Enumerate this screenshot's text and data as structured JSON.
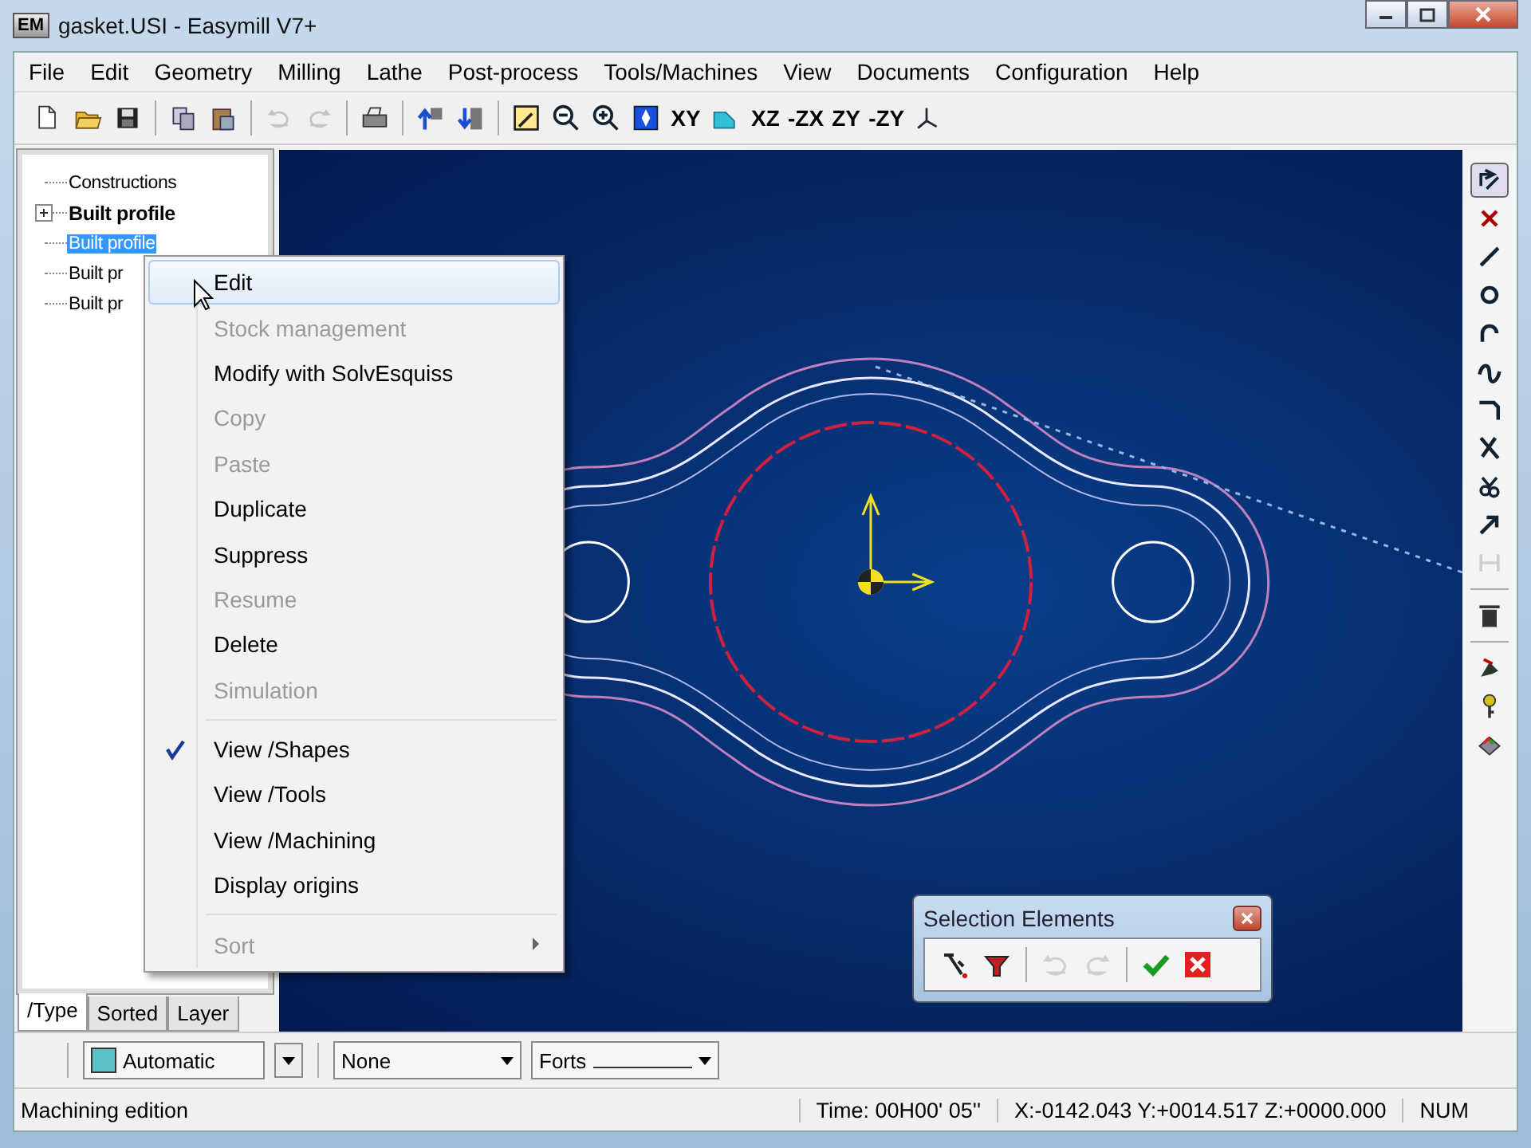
{
  "window": {
    "logo": "EM",
    "title": "gasket.USI - Easymill V7+"
  },
  "menu_bar": [
    "File",
    "Edit",
    "Geometry",
    "Milling",
    "Lathe",
    "Post-process",
    "Tools/Machines",
    "View",
    "Documents",
    "Configuration",
    "Help"
  ],
  "toolbar": [
    {
      "kind": "icon",
      "disabled": false
    },
    {
      "kind": "icon",
      "disabled": false
    },
    {
      "kind": "icon",
      "disabled": false
    },
    {
      "kind": "separator"
    },
    {
      "kind": "icon",
      "disabled": false
    },
    {
      "kind": "icon",
      "disabled": false
    },
    {
      "kind": "separator"
    },
    {
      "kind": "icon",
      "disabled": true
    },
    {
      "kind": "icon",
      "disabled": true
    },
    {
      "kind": "separator"
    },
    {
      "kind": "icon",
      "disabled": false
    },
    {
      "kind": "separator"
    },
    {
      "kind": "icon",
      "disabled": false
    },
    {
      "kind": "icon",
      "disabled": false
    },
    {
      "kind": "separator"
    },
    {
      "kind": "icon",
      "disabled": false
    },
    {
      "kind": "icon",
      "disabled": false
    },
    {
      "kind": "icon",
      "disabled": false
    },
    {
      "kind": "icon",
      "disabled": false
    },
    {
      "kind": "text",
      "label": "XY",
      "disabled": false
    },
    {
      "kind": "icon",
      "disabled": false
    },
    {
      "kind": "text",
      "label": "XZ",
      "disabled": false
    },
    {
      "kind": "text",
      "label": "-ZX",
      "disabled": false
    },
    {
      "kind": "text",
      "label": "ZY",
      "disabled": false
    },
    {
      "kind": "text",
      "label": "-ZY",
      "disabled": false
    },
    {
      "kind": "icon",
      "disabled": false
    }
  ],
  "tree": [
    {
      "label": "Constructions",
      "bold": false,
      "selected": false
    },
    {
      "label": "Built profile",
      "bold": true,
      "selected": false,
      "expanded": false
    },
    {
      "label": "Built profile",
      "bold": false,
      "selected": true
    },
    {
      "label": "Built pr",
      "bold": false,
      "selected": false
    },
    {
      "label": "Built pr",
      "bold": false,
      "selected": false
    }
  ],
  "tree_tabs": [
    {
      "label": "/Type",
      "selected": true
    },
    {
      "label": "Sorted",
      "selected": false
    },
    {
      "label": "Layer",
      "selected": false
    }
  ],
  "context_menu": [
    {
      "kind": "item",
      "label": "Edit",
      "disabled": false,
      "checked": false,
      "selected": true
    },
    {
      "kind": "item",
      "label": "Stock management",
      "disabled": true,
      "checked": false,
      "selected": false
    },
    {
      "kind": "item",
      "label": "Modify with SolvEsquiss",
      "disabled": false,
      "checked": false,
      "selected": false
    },
    {
      "kind": "item",
      "label": "Copy",
      "disabled": true,
      "checked": false,
      "selected": false
    },
    {
      "kind": "item",
      "label": "Paste",
      "disabled": true,
      "checked": false,
      "selected": false
    },
    {
      "kind": "item",
      "label": "Duplicate",
      "disabled": false,
      "checked": false,
      "selected": false
    },
    {
      "kind": "item",
      "label": "Suppress",
      "disabled": false,
      "checked": false,
      "selected": false
    },
    {
      "kind": "item",
      "label": "Resume",
      "disabled": true,
      "checked": false,
      "selected": false
    },
    {
      "kind": "item",
      "label": "Delete",
      "disabled": false,
      "checked": false,
      "selected": false
    },
    {
      "kind": "item",
      "label": "Simulation",
      "disabled": true,
      "checked": false,
      "selected": false
    },
    {
      "kind": "separator"
    },
    {
      "kind": "item",
      "label": "View /Shapes",
      "disabled": false,
      "checked": true,
      "selected": false
    },
    {
      "kind": "item",
      "label": "View /Tools",
      "disabled": false,
      "checked": false,
      "selected": false
    },
    {
      "kind": "item",
      "label": "View /Machining",
      "disabled": false,
      "checked": false,
      "selected": false
    },
    {
      "kind": "item",
      "label": "Display origins",
      "disabled": false,
      "checked": false,
      "selected": false
    },
    {
      "kind": "separator"
    },
    {
      "kind": "submenu",
      "label": "Sort",
      "disabled": true,
      "checked": false,
      "selected": false
    }
  ],
  "right_toolbar": [
    {
      "kind": "icon",
      "selected": true,
      "disabled": false
    },
    {
      "kind": "icon",
      "selected": false,
      "disabled": false
    },
    {
      "kind": "icon",
      "selected": false,
      "disabled": false
    },
    {
      "kind": "icon",
      "selected": false,
      "disabled": false
    },
    {
      "kind": "icon",
      "selected": false,
      "disabled": false
    },
    {
      "kind": "icon",
      "selected": false,
      "disabled": false
    },
    {
      "kind": "icon",
      "selected": false,
      "disabled": false
    },
    {
      "kind": "icon",
      "selected": false,
      "disabled": false
    },
    {
      "kind": "icon",
      "selected": false,
      "disabled": false
    },
    {
      "kind": "icon",
      "selected": false,
      "disabled": false
    },
    {
      "kind": "icon",
      "selected": false,
      "disabled": true
    },
    {
      "kind": "separator"
    },
    {
      "kind": "icon",
      "selected": false,
      "disabled": false
    },
    {
      "kind": "separator"
    },
    {
      "kind": "icon",
      "selected": false,
      "disabled": false
    },
    {
      "kind": "icon",
      "selected": false,
      "disabled": false
    },
    {
      "kind": "icon",
      "selected": false,
      "disabled": false
    }
  ],
  "selection_panel": {
    "title": "Selection Elements",
    "tools": [
      {
        "kind": "icon",
        "disabled": false
      },
      {
        "kind": "icon",
        "disabled": false
      },
      {
        "kind": "separator"
      },
      {
        "kind": "icon",
        "disabled": true
      },
      {
        "kind": "icon",
        "disabled": true
      },
      {
        "kind": "separator"
      },
      {
        "kind": "icon",
        "disabled": false
      },
      {
        "kind": "icon",
        "disabled": false
      }
    ]
  },
  "bottom_bar": {
    "color": {
      "value": "Automatic",
      "color": "#5bc0c8"
    },
    "line_type": {
      "value": "None"
    },
    "line_weight": {
      "value": "Forts"
    }
  },
  "status_bar": {
    "message": "Machining edition",
    "time": "Time: 00H00' 05''",
    "coordinates": "X:-0142.043 Y:+0014.517 Z:+0000.000",
    "mode": "NUM"
  }
}
